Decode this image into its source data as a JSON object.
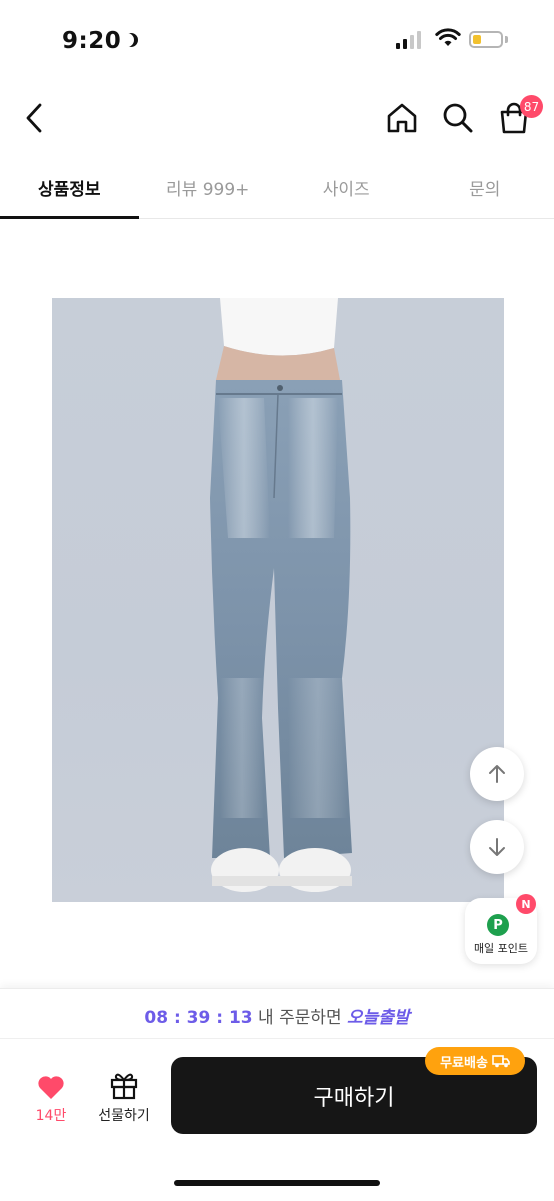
{
  "status_bar": {
    "time": "9:20"
  },
  "header": {
    "cart_count": "87"
  },
  "tabs": [
    {
      "label": "상품정보",
      "active": true
    },
    {
      "label": "리뷰 999+",
      "active": false
    },
    {
      "label": "사이즈",
      "active": false
    },
    {
      "label": "문의",
      "active": false
    }
  ],
  "floating": {
    "point_label": "매일 포인트",
    "point_icon_letter": "P",
    "new_badge": "N"
  },
  "delivery": {
    "timer": "08 : 39 : 13",
    "middle": " 내 주문하면 ",
    "today": "오늘출발"
  },
  "bottom_bar": {
    "like_count": "14만",
    "gift_label": "선물하기",
    "buy_label": "구매하기",
    "shipping_badge": "무료배송"
  },
  "colors": {
    "accent": "#6d5ce8",
    "badge": "#ff4a6a",
    "shipping": "#ffa20e",
    "buy_button": "#161616",
    "point": "#1ea04e"
  }
}
